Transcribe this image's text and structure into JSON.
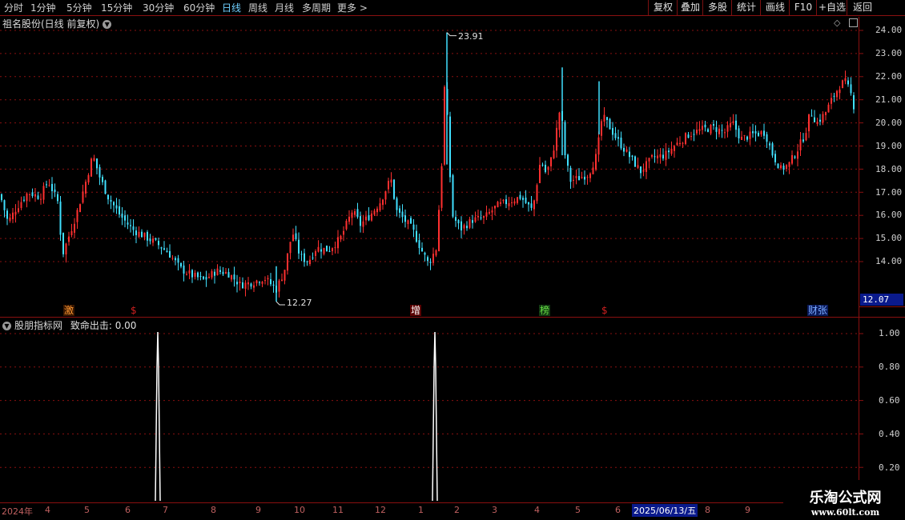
{
  "toolbar": {
    "timeframes": [
      "分时",
      "1分钟",
      "5分钟",
      "15分钟",
      "30分钟",
      "60分钟",
      "日线",
      "周线",
      "月线",
      "多周期",
      "更多 >"
    ],
    "active_timeframe": "日线",
    "buttons": [
      "复权",
      "叠加",
      "多股",
      "统计",
      "画线",
      "F10",
      "+自选",
      "返回"
    ]
  },
  "main_panel": {
    "title": "祖名股份(日线 前复权)",
    "high_label": "23.91",
    "low_label": "12.27",
    "current_price": "12.07",
    "y_ticks": [
      "24.00",
      "23.00",
      "22.00",
      "21.00",
      "20.00",
      "19.00",
      "18.00",
      "17.00",
      "16.00",
      "15.00",
      "14.00"
    ],
    "markers": [
      {
        "text": "激",
        "color": "#ff9933"
      },
      {
        "text": "$",
        "color": "#d02020"
      },
      {
        "text": "增",
        "color": "#ffffff"
      },
      {
        "text": "榜",
        "color": "#66dd44"
      },
      {
        "text": "$",
        "color": "#d02020"
      },
      {
        "text": "财张",
        "color": "#7aaaff"
      }
    ]
  },
  "indicator_panel": {
    "title": "股朋指标网",
    "indicator_label": "致命出击: 0.00",
    "y_ticks": [
      "1.00",
      "0.80",
      "0.60",
      "0.40",
      "0.20"
    ]
  },
  "x_axis": {
    "labels": [
      "2024年",
      "4",
      "5",
      "6",
      "7",
      "8",
      "9",
      "10",
      "11",
      "12",
      "1",
      "2",
      "3",
      "4",
      "5",
      "6",
      "2025/06/13/五",
      "8",
      "9"
    ]
  },
  "watermark": {
    "title": "乐淘公式网",
    "url": "www.60lt.com"
  },
  "colors": {
    "up": "#ff3030",
    "down": "#40e0ff",
    "grid": "#8a1010",
    "active_tab": "#6fd0ff"
  }
}
